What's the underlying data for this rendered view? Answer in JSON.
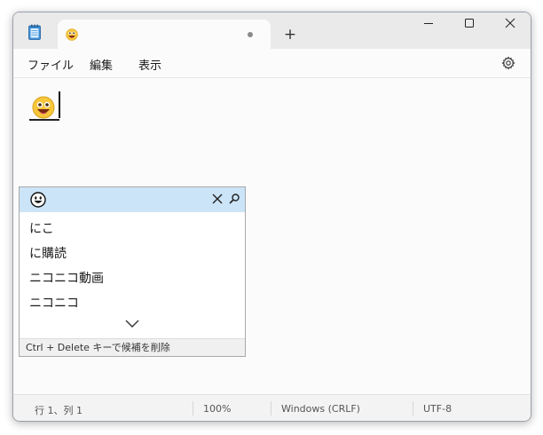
{
  "titlebar": {
    "app_icon": "notepad-icon",
    "tab_icon": "grinning-face-emoji",
    "tab_modified_indicator": "unsaved-dot",
    "new_tab_label": "+"
  },
  "window_controls": [
    "minimize-icon",
    "maximize-icon",
    "close-icon"
  ],
  "menu": {
    "file": "ファイル",
    "edit": "編集",
    "view": "表示",
    "settings_icon": "gear-icon"
  },
  "editor": {
    "content_emoji": "grinning-face-emoji"
  },
  "ime_popup": {
    "selected_candidate": "😀",
    "close_icon": "close-icon",
    "search_icon": "search-icon",
    "candidates": [
      "にこ",
      "に購読",
      "ニコニコ動画",
      "ニコニコ"
    ],
    "expand_icon": "chevron-down-icon",
    "footer": "Ctrl + Delete キーで候補を削除"
  },
  "status": {
    "position": "行 1、列 1",
    "zoom": "100%",
    "line_ending": "Windows (CRLF)",
    "encoding": "UTF-8"
  },
  "colors": {
    "selection": "#cce4f7",
    "emoji_yellow": "#f7c63a",
    "emoji_tongue": "#e0407a"
  }
}
